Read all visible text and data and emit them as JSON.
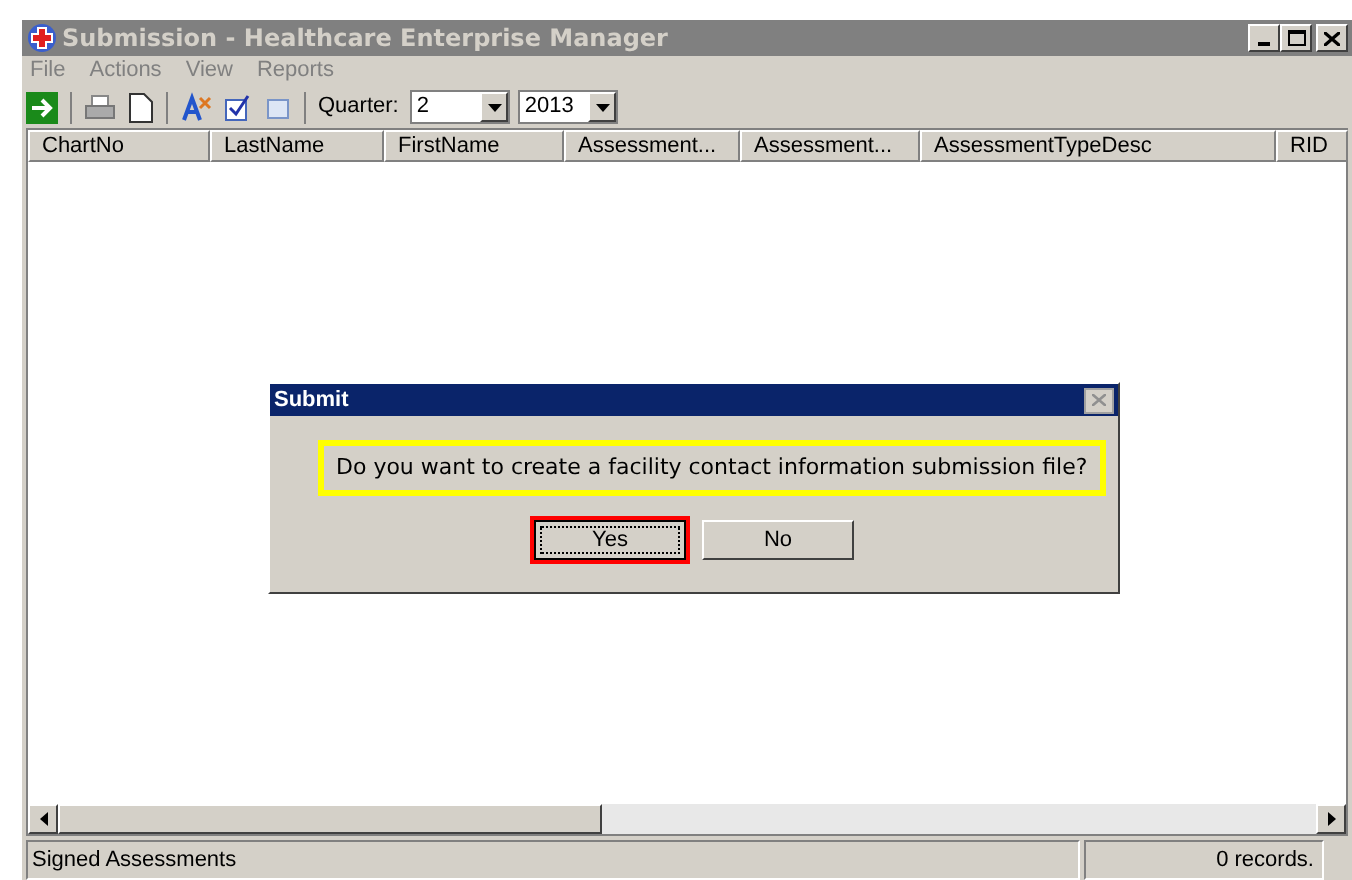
{
  "window": {
    "title": "Submission - Healthcare Enterprise Manager",
    "active": false
  },
  "menu": [
    {
      "label": "File",
      "disabled": true
    },
    {
      "label": "Actions",
      "disabled": true
    },
    {
      "label": "View",
      "disabled": true
    },
    {
      "label": "Reports",
      "disabled": true
    }
  ],
  "toolbar": {
    "quarter_label": "Quarter:",
    "quarter": "2",
    "year": "2013"
  },
  "table": {
    "columns": [
      "ChartNo",
      "LastName",
      "FirstName",
      "Assessment...",
      "Assessment...",
      "AssessmentTypeDesc",
      "RID"
    ]
  },
  "status_bar": {
    "left": "Signed Assessments",
    "right": "0 records."
  },
  "dialog": {
    "title": "Submit",
    "message": "Do you want to create a facility contact information submission file?",
    "message_highlighted": true,
    "buttons": [
      {
        "label": "Yes",
        "focused": true,
        "highlighted": true
      },
      {
        "label": "No",
        "focused": false,
        "highlighted": false
      }
    ]
  }
}
